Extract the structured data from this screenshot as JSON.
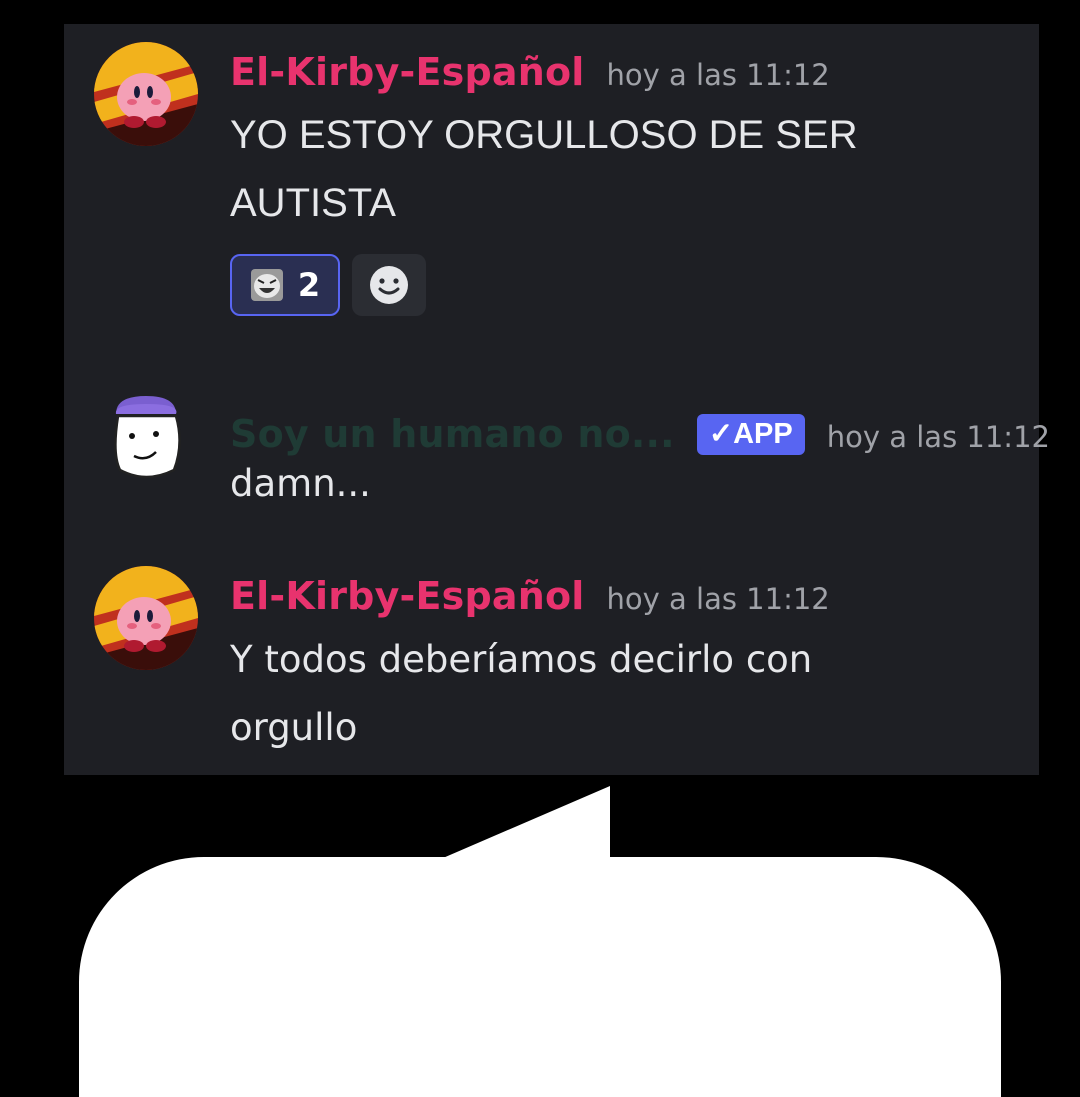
{
  "messages": [
    {
      "username": "El-Kirby-Español",
      "timestamp": "hoy a las 11:12",
      "content": "YO ESTOY ORGULLOSO DE SER AUTISTA",
      "reactions": [
        {
          "emoji_icon": "laughing-face-emoji-icon",
          "count": "2",
          "active": true
        }
      ],
      "add_reaction_icon": "smiley-add-reaction-icon"
    },
    {
      "username": "Soy un humano no...",
      "badge": "✓APP",
      "timestamp": "hoy a las 11:12",
      "content": "damn..."
    },
    {
      "username": "El-Kirby-Español",
      "timestamp": "hoy a las 11:12",
      "content": "Y todos deberíamos decirlo con orgullo"
    }
  ],
  "colors": {
    "chat_background": "#1e1f24",
    "username_pink": "#e8336e",
    "bot_username": "#1f3b35",
    "app_badge": "#5865f2",
    "timestamp": "#a0a2a8",
    "message_text": "#e6e7ea",
    "page_background": "#000000",
    "speech_bubble": "#ffffff"
  }
}
